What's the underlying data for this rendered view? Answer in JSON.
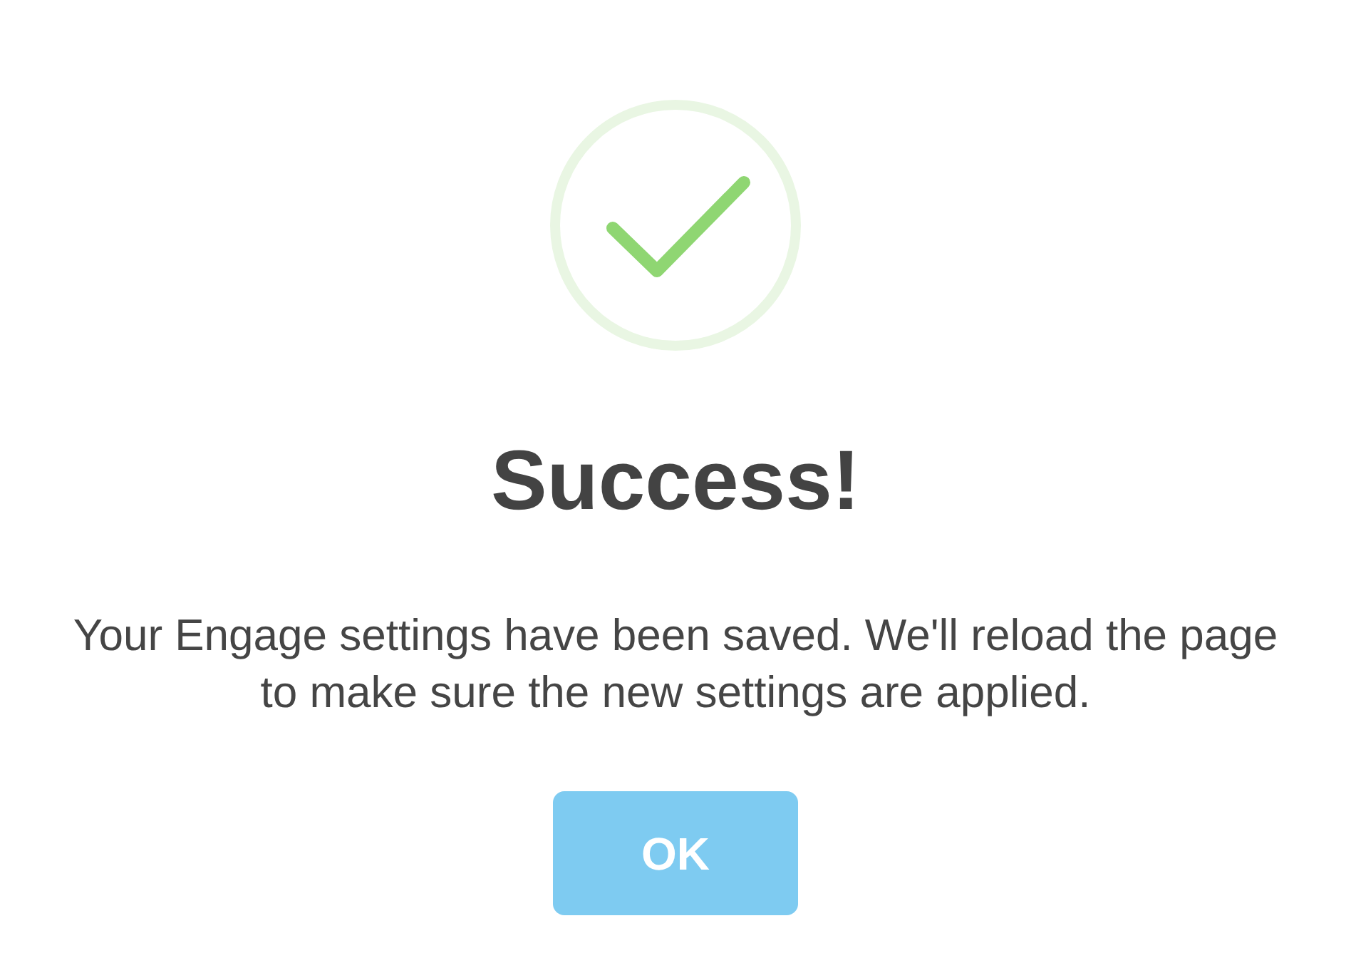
{
  "dialog": {
    "title": "Success!",
    "message": "Your Engage settings have been saved. We'll reload the page to make sure the new settings are applied.",
    "button": {
      "label": "OK"
    }
  }
}
